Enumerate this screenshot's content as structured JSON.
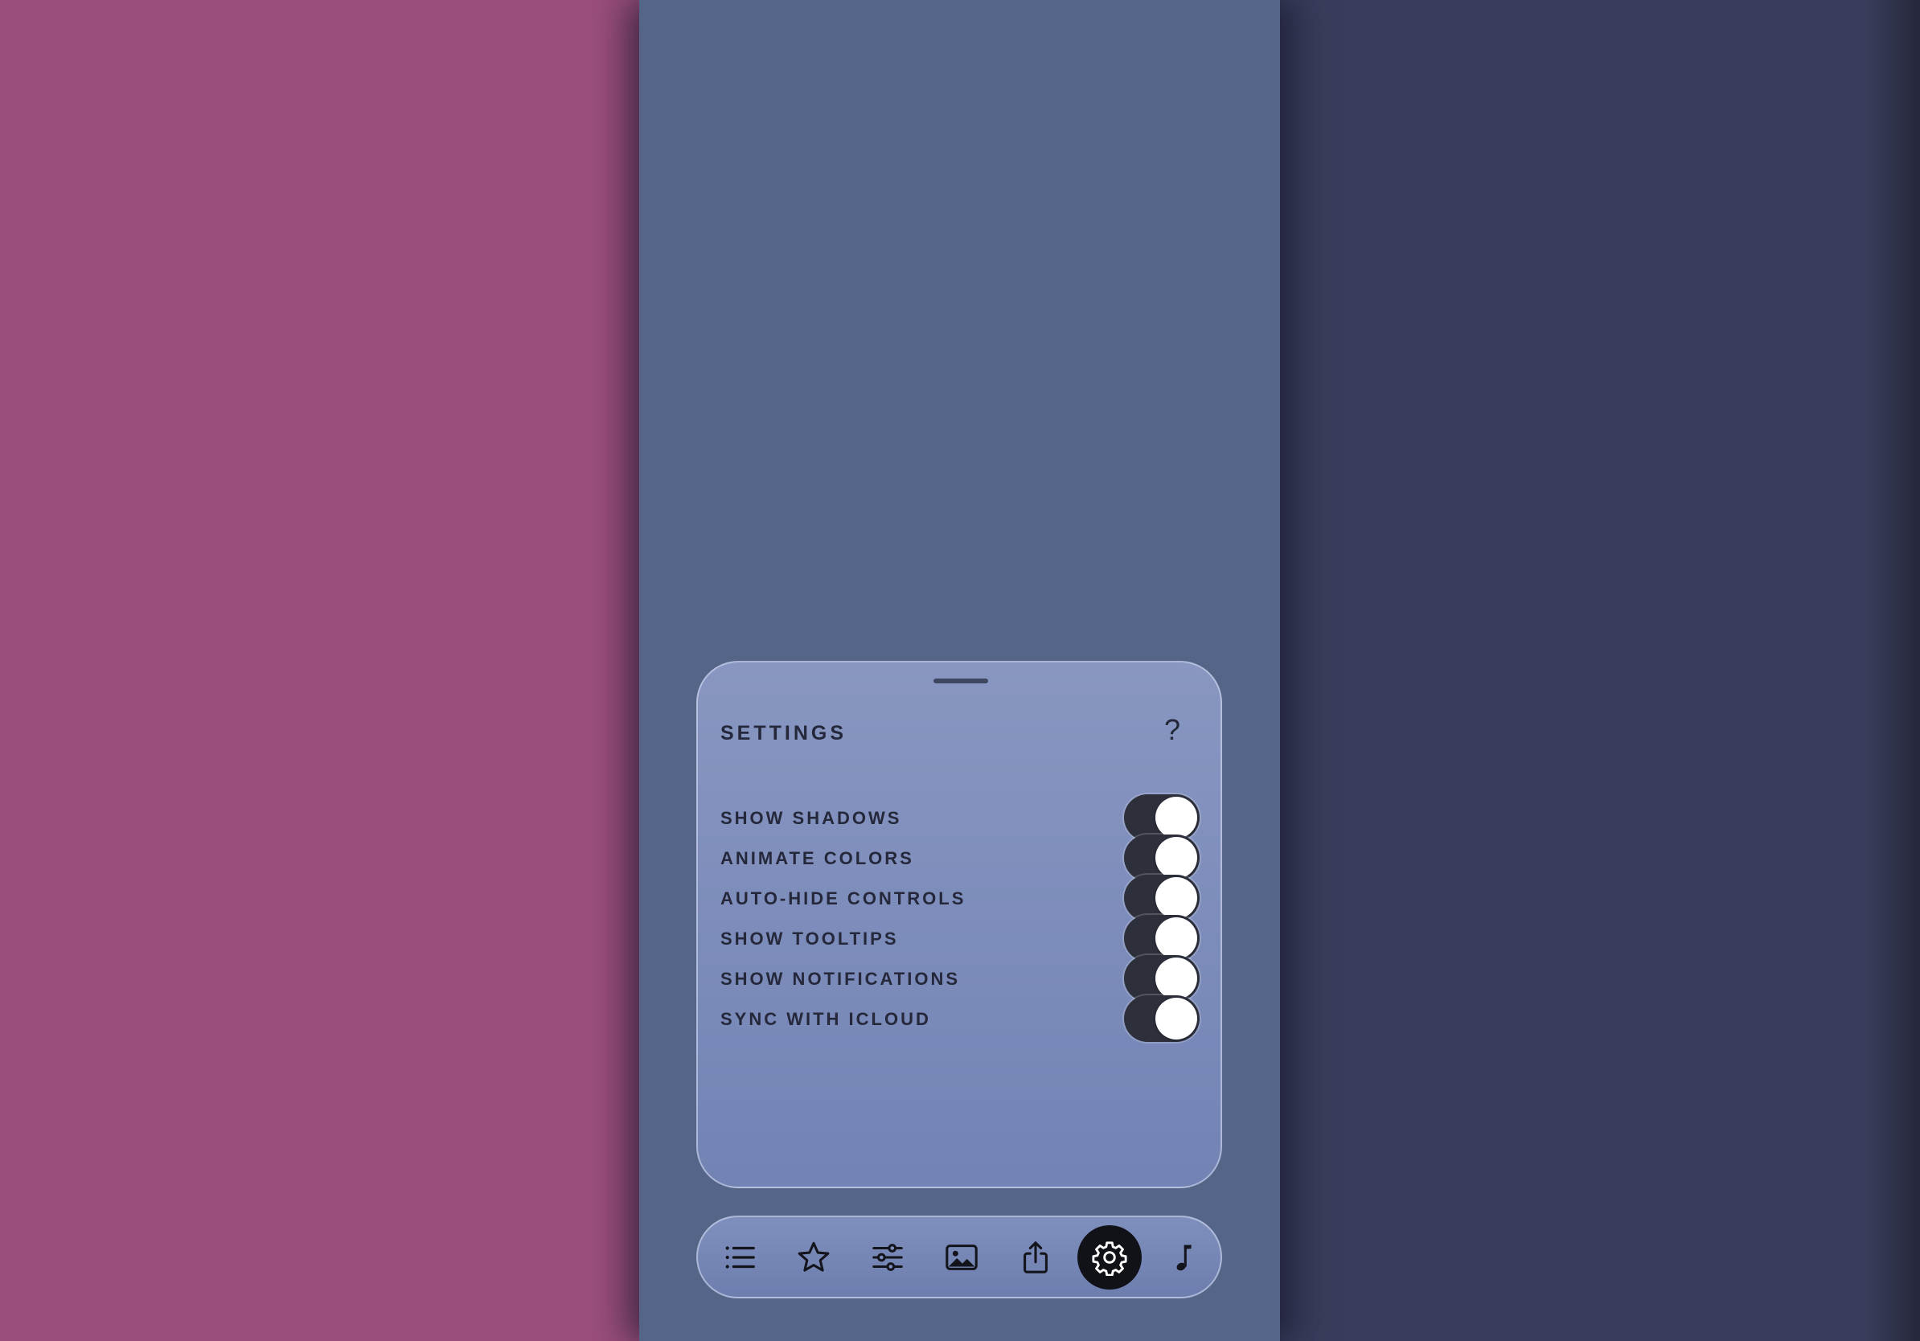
{
  "colors": {
    "left_column": "#9a4f7a",
    "middle_column": "#556588",
    "right_column": "#393d5b",
    "panel_bg": "#7f8fbd",
    "toggle_on_track": "#2d2f3b",
    "tab_active_bg": "#111217"
  },
  "settings": {
    "title": "SETTINGS",
    "help_label": "?",
    "items": [
      {
        "label": "SHOW SHADOWS",
        "on": true
      },
      {
        "label": "ANIMATE COLORS",
        "on": true
      },
      {
        "label": "AUTO-HIDE CONTROLS",
        "on": true
      },
      {
        "label": "SHOW TOOLTIPS",
        "on": true
      },
      {
        "label": "SHOW NOTIFICATIONS",
        "on": true
      },
      {
        "label": "SYNC WITH ICLOUD",
        "on": true
      }
    ]
  },
  "tabbar": {
    "tabs": [
      {
        "icon": "list-icon",
        "active": false
      },
      {
        "icon": "star-icon",
        "active": false
      },
      {
        "icon": "sliders-icon",
        "active": false
      },
      {
        "icon": "image-icon",
        "active": false
      },
      {
        "icon": "share-icon",
        "active": false
      },
      {
        "icon": "gear-icon",
        "active": true
      },
      {
        "icon": "music-note-icon",
        "active": false
      }
    ]
  }
}
